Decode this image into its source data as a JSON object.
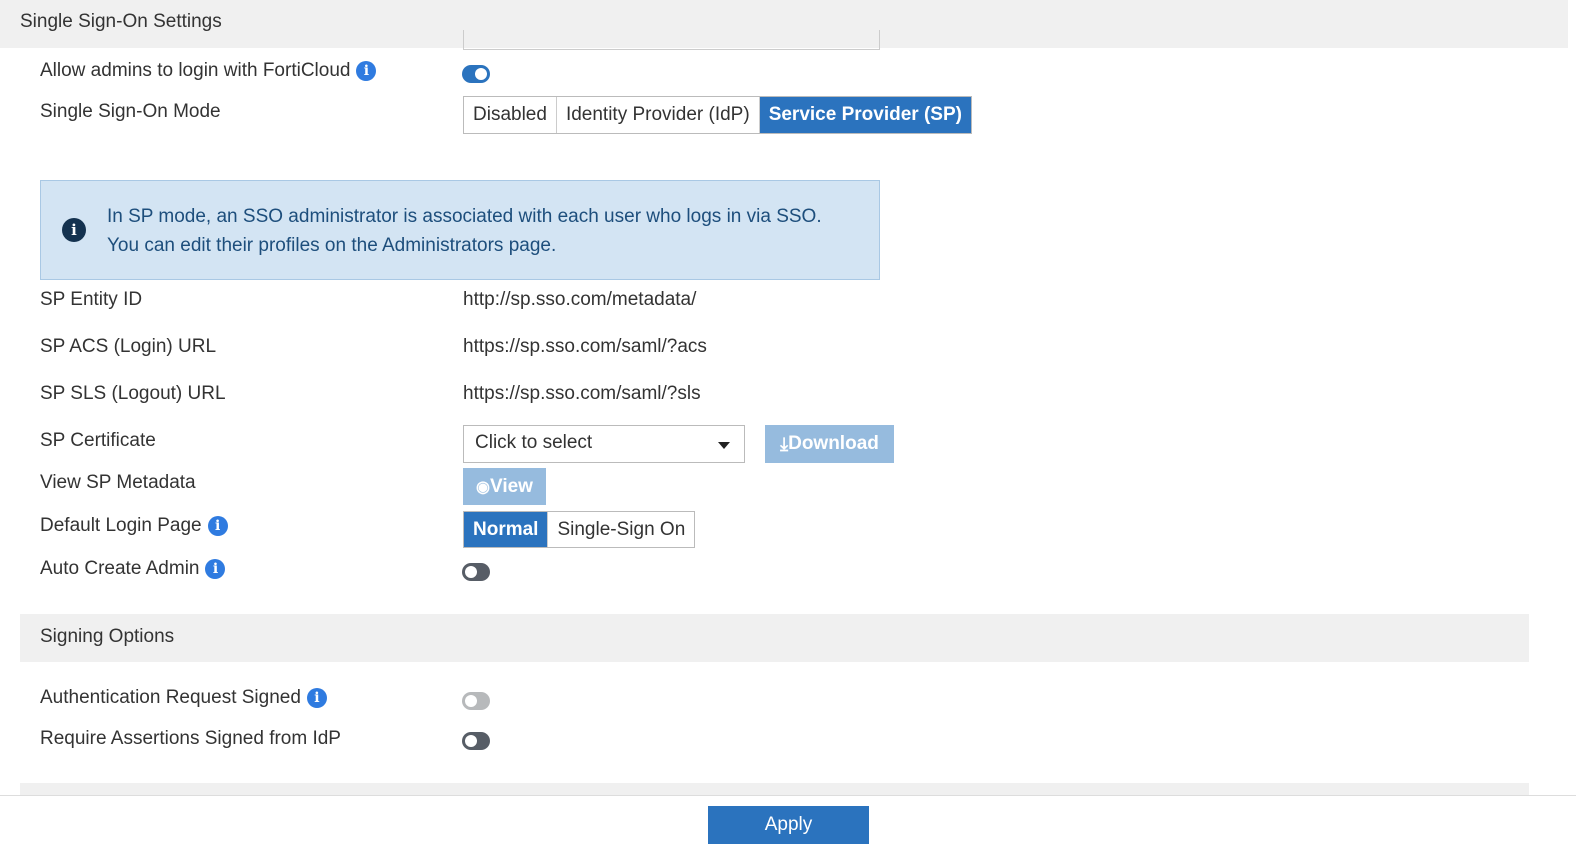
{
  "header": {
    "title": "Single Sign-On Settings"
  },
  "fields": {
    "allow_forticloud": {
      "label": "Allow admins to login with FortiCloud",
      "enabled": true
    },
    "sso_mode": {
      "label": "Single Sign-On Mode",
      "options": [
        "Disabled",
        "Identity Provider (IdP)",
        "Service Provider (SP)"
      ],
      "selected": "Service Provider (SP)"
    },
    "info_message": {
      "line1": "In SP mode, an SSO administrator is associated with each user who logs in via SSO.",
      "line2": "You can edit their profiles on the Administrators page."
    },
    "sp_entity_id": {
      "label": "SP Entity ID",
      "value": "http://sp.sso.com/metadata/"
    },
    "sp_acs_url": {
      "label": "SP ACS (Login) URL",
      "value": "https://sp.sso.com/saml/?acs"
    },
    "sp_sls_url": {
      "label": "SP SLS (Logout) URL",
      "value": "https://sp.sso.com/saml/?sls"
    },
    "sp_certificate": {
      "label": "SP Certificate",
      "placeholder": "Click to select",
      "download_label": "Download"
    },
    "view_metadata": {
      "label": "View SP Metadata",
      "button_label": "View"
    },
    "default_login_page": {
      "label": "Default Login Page",
      "options": [
        "Normal",
        "Single-Sign On"
      ],
      "selected": "Normal"
    },
    "auto_create_admin": {
      "label": "Auto Create Admin",
      "enabled": false
    }
  },
  "signing": {
    "title": "Signing Options",
    "auth_request_signed": {
      "label": "Authentication Request Signed",
      "enabled": false,
      "disabled": true
    },
    "require_assertions_signed": {
      "label": "Require Assertions Signed from IdP",
      "enabled": false
    }
  },
  "footer": {
    "apply_label": "Apply"
  },
  "colors": {
    "accent": "#2b73be",
    "info_bg": "#d3e4f3",
    "header_bg": "#f0f0f0"
  }
}
